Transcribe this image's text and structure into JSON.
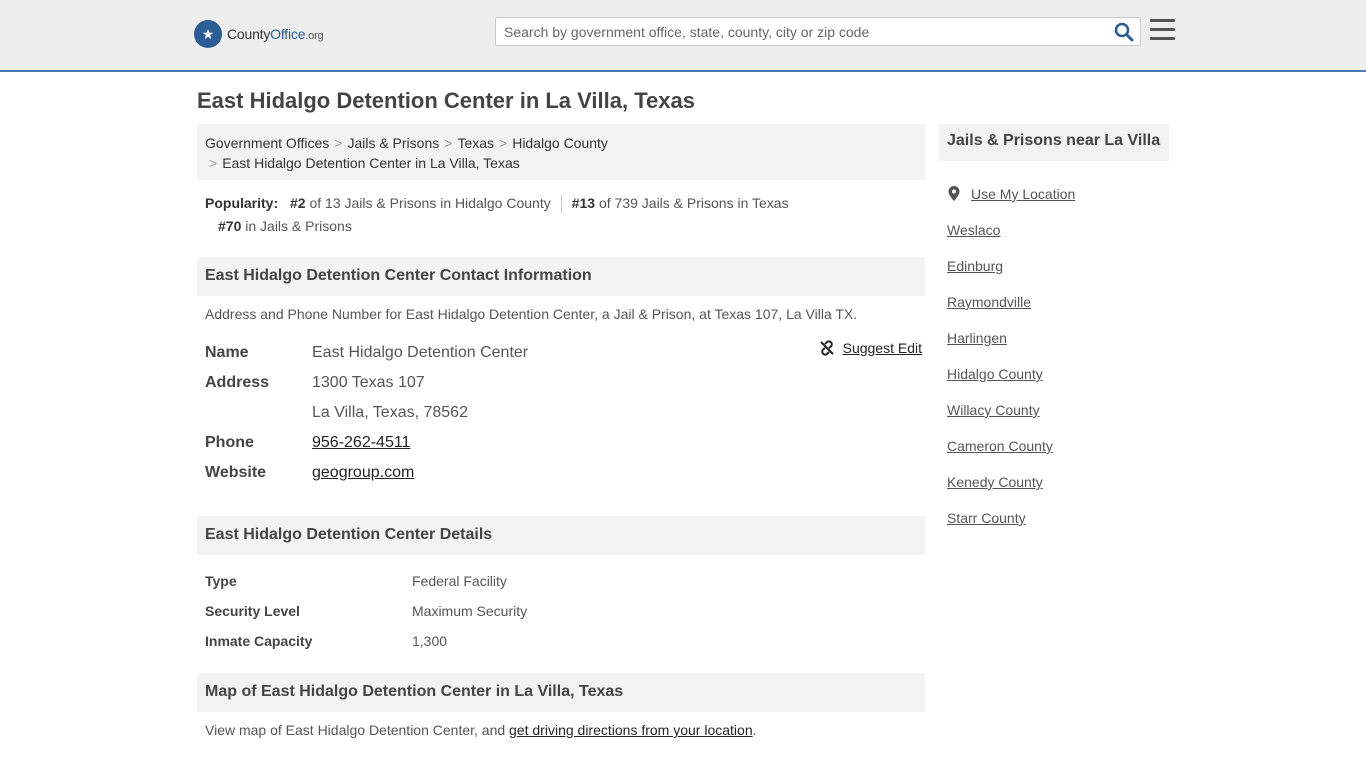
{
  "brand": {
    "name_pre": "County",
    "name_highlight": "Office",
    "name_suffix": ".org"
  },
  "search": {
    "placeholder": "Search by government office, state, county, city or zip code"
  },
  "page_title": "East Hidalgo Detention Center in La Villa, Texas",
  "breadcrumb": [
    "Government Offices",
    "Jails & Prisons",
    "Texas",
    "Hidalgo County",
    "East Hidalgo Detention Center in La Villa, Texas"
  ],
  "popularity": {
    "label": "Popularity:",
    "items": [
      {
        "rank": "#2",
        "text": " of 13 Jails & Prisons in Hidalgo County"
      },
      {
        "rank": "#13",
        "text": " of 739 Jails & Prisons in Texas"
      },
      {
        "rank": "#70",
        "text": " in Jails & Prisons"
      }
    ]
  },
  "contact": {
    "heading": "East Hidalgo Detention Center Contact Information",
    "description": "Address and Phone Number for East Hidalgo Detention Center, a Jail & Prison, at Texas 107, La Villa TX.",
    "suggest_edit": "Suggest Edit",
    "rows": [
      {
        "label": "Name",
        "value": "East Hidalgo Detention Center"
      },
      {
        "label": "Address",
        "value": "1300 Texas 107"
      },
      {
        "label": "",
        "value": "La Villa, Texas, 78562"
      },
      {
        "label": "Phone",
        "value": "956-262-4511"
      },
      {
        "label": "Website",
        "value": "geogroup.com"
      }
    ]
  },
  "details": {
    "heading": "East Hidalgo Detention Center Details",
    "rows": [
      {
        "label": "Type",
        "value": "Federal Facility"
      },
      {
        "label": "Security Level",
        "value": "Maximum Security"
      },
      {
        "label": "Inmate Capacity",
        "value": "1,300"
      }
    ]
  },
  "map": {
    "heading": "Map of East Hidalgo Detention Center in La Villa, Texas",
    "text_before": "View map of East Hidalgo Detention Center, and ",
    "link": "get driving directions from your location",
    "text_after": "."
  },
  "sidebar": {
    "heading": "Jails & Prisons near La Villa",
    "use_location": "Use My Location",
    "items": [
      "Weslaco",
      "Edinburg",
      "Raymondville",
      "Harlingen",
      "Hidalgo County",
      "Willacy County",
      "Cameron County",
      "Kenedy County",
      "Starr County"
    ]
  },
  "colors": {
    "accent": "#4a7ab0",
    "brand": "#2b5c94",
    "panel": "#f3f3f3",
    "topbar": "#eeeeef"
  }
}
